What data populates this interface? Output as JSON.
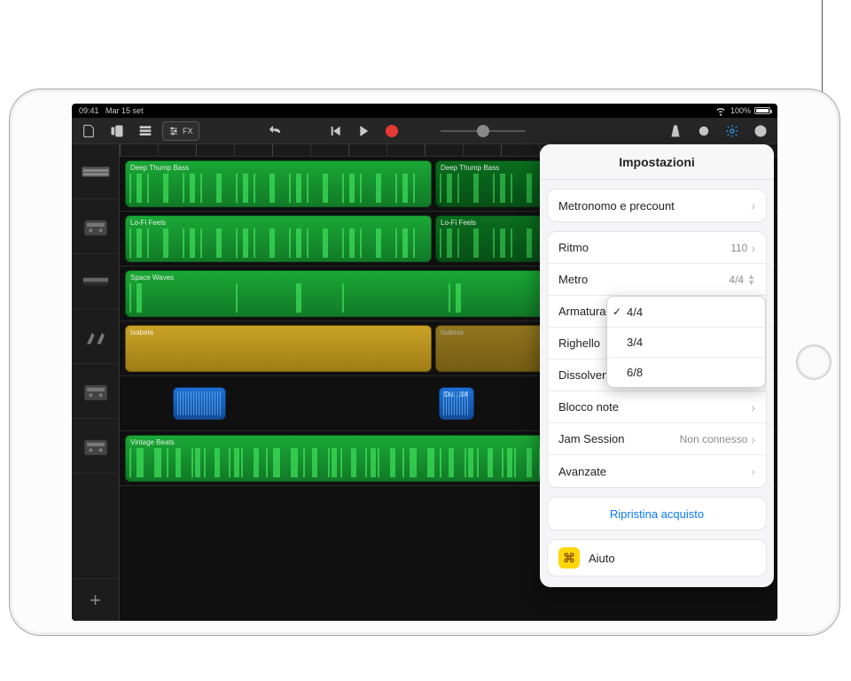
{
  "status": {
    "time": "09:41",
    "date": "Mar 15 set",
    "battery_pct": "100%"
  },
  "toolbar": {
    "fx_label": "FX"
  },
  "tracks": [
    {
      "name": "Deep Thump Bass"
    },
    {
      "name": "Lo-Fi Feels"
    },
    {
      "name": "Space Waves"
    },
    {
      "name": "Isabela"
    },
    {
      "name": "Du…04"
    },
    {
      "name": "Vintage Beats"
    }
  ],
  "settings": {
    "title": "Impostazioni",
    "metronome": "Metronomo e precount",
    "tempo_label": "Ritmo",
    "tempo_value": "110",
    "metro_label": "Metro",
    "metro_value": "4/4",
    "armature_label": "Armatura",
    "ruler_label": "Righello",
    "fadeout": "Dissolvenza in chiusura",
    "notepad": "Blocco note",
    "jam_label": "Jam Session",
    "jam_value": "Non connesso",
    "advanced": "Avanzate",
    "restore": "Ripristina acquisto",
    "help": "Aiuto",
    "metro_options": {
      "o1": "4/4",
      "o2": "3/4",
      "o3": "6/8"
    }
  }
}
